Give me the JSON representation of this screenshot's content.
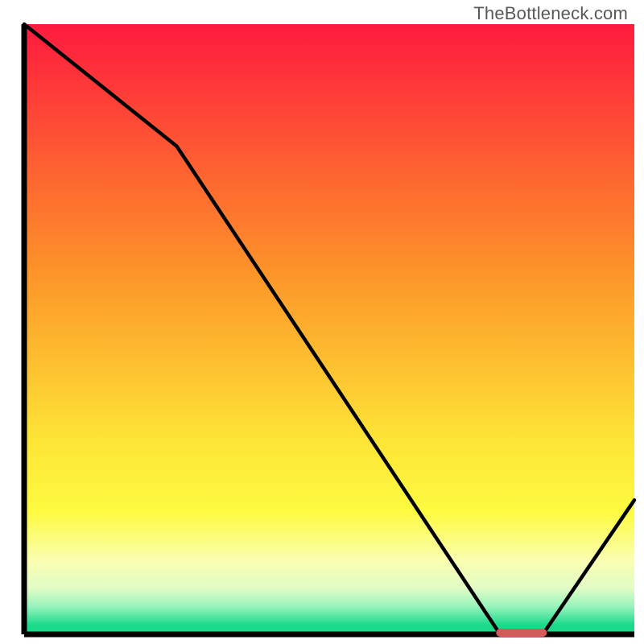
{
  "watermark": "TheBottleneck.com",
  "colors": {
    "top": "#fe1a3e",
    "mid1": "#fd9229",
    "mid2": "#fde436",
    "mid3": "#fdfa41",
    "mid4": "#fafeb2",
    "mid5": "#e0fcc6",
    "mid6": "#96f3bb",
    "bottom": "#1ada8a",
    "axis": "#000000",
    "line": "#000000",
    "marker": "#d55a5a"
  },
  "chart_data": {
    "type": "line",
    "title": "",
    "xlabel": "",
    "ylabel": "",
    "xlim": [
      0,
      100
    ],
    "ylim": [
      0,
      100
    ],
    "x": [
      0,
      25,
      78,
      85,
      100
    ],
    "values": [
      100,
      80,
      0,
      0,
      22
    ],
    "marker": {
      "x_start": 78,
      "x_end": 85,
      "y": 0
    },
    "annotations": []
  }
}
